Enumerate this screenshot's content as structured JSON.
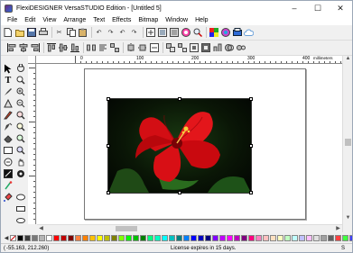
{
  "window": {
    "title": "FlexiDESIGNER VersaSTUDIO Edition - [Untitled 5]",
    "minimize": "–",
    "maximize": "☐",
    "close": "✕"
  },
  "menu": [
    "File",
    "Edit",
    "View",
    "Arrange",
    "Text",
    "Effects",
    "Bitmap",
    "Window",
    "Help"
  ],
  "ruler": {
    "unit": "millimeters",
    "labels": [
      "0",
      "100",
      "200",
      "300",
      "400"
    ]
  },
  "status": {
    "coordinates": "-55.163,  212.260)",
    "license": "License expires in 15 days.",
    "right_glyph": "S"
  },
  "colors": {
    "accent": "#2c6ad8",
    "selection_handle": "#ffffff",
    "page_border": "#777777"
  },
  "palette": [
    "#000000",
    "#3c3c3c",
    "#787878",
    "#b4b4b4",
    "#ffffff",
    "#ff0000",
    "#c00000",
    "#800000",
    "#ff8040",
    "#ff8000",
    "#ffc000",
    "#ffff00",
    "#c0c000",
    "#808000",
    "#80ff00",
    "#00ff00",
    "#00c000",
    "#008000",
    "#00ff80",
    "#00ffc0",
    "#00ffff",
    "#00c0c0",
    "#008080",
    "#0080ff",
    "#0000ff",
    "#0000c0",
    "#000080",
    "#8000ff",
    "#c000ff",
    "#ff00ff",
    "#c000c0",
    "#800080",
    "#ff0080",
    "#ff80c0",
    "#ffc0c0",
    "#ffe0c0",
    "#ffffc0",
    "#c0ffc0",
    "#c0ffff",
    "#c0c0ff",
    "#ffc0ff",
    "#e0e0e0",
    "#a0a0a0",
    "#606060",
    "#ff4040",
    "#40ff40",
    "#4040ff",
    "#ffa040",
    "#40a0ff",
    "#a040ff"
  ],
  "icons": {
    "row1": [
      "new-icon",
      "open-icon",
      "save-icon",
      "print-icon",
      "cut-icon",
      "copy-icon",
      "paste-icon",
      "undo-icon",
      "redo-icon",
      "undo-alt-icon",
      "redo-alt-icon",
      "import-icon",
      "export-icon",
      "scan-icon",
      "color-wheel-icon",
      "zoom-icon",
      "color-icon",
      "swatch-icon",
      "output-icon",
      "cloud-icon"
    ],
    "row2": [
      "align-left-icon",
      "align-center-icon",
      "align-right-icon",
      "align-top-icon",
      "align-middle-icon",
      "align-bottom-icon",
      "space-h-icon",
      "text-align-icon",
      "distribute-icon",
      "center-h-icon",
      "center-v-icon",
      "weld-icon",
      "group-icon",
      "ungroup-icon",
      "order-front-icon",
      "order-back-icon",
      "arrange-icon",
      "combine-icon",
      "break-icon"
    ]
  }
}
